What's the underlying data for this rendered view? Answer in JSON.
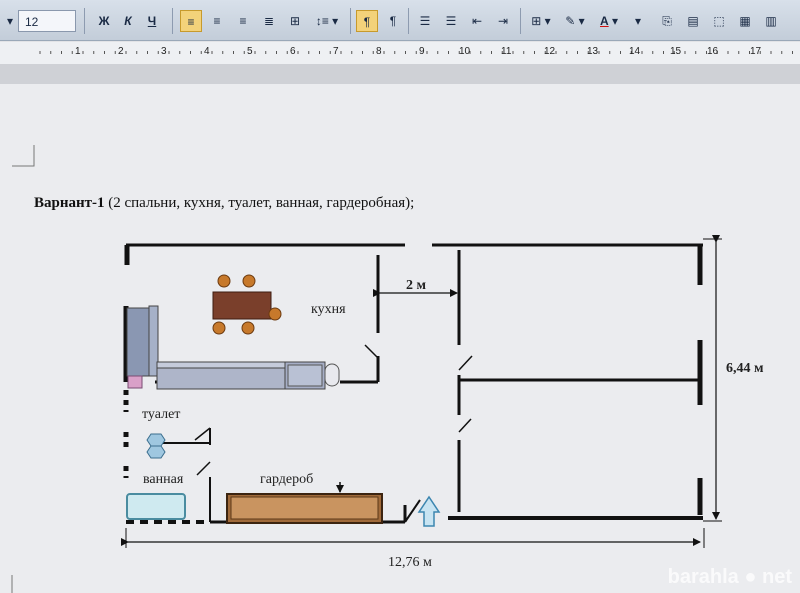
{
  "toolbar": {
    "font_size": "12",
    "bold": "Ж",
    "italic": "К",
    "underline": "Ч",
    "highlight_letter": "A"
  },
  "ruler": {
    "numbers": [
      "1",
      "2",
      "3",
      "4",
      "5",
      "6",
      "7",
      "8",
      "9",
      "10",
      "11",
      "12",
      "13",
      "14",
      "15",
      "16",
      "17"
    ]
  },
  "document": {
    "heading_bold": "Варнант-1",
    "heading_rest": " (2 спальни, кухня, туалет, ванная, гардеробная);"
  },
  "plan": {
    "kitchen": "кухня",
    "toilet": "туалет",
    "bathroom": "ванная",
    "wardrobe": "гардероб",
    "corridor_width": "2 м",
    "height": "6,44 м",
    "length": "12,76 м"
  },
  "watermark": "barahla ● net"
}
